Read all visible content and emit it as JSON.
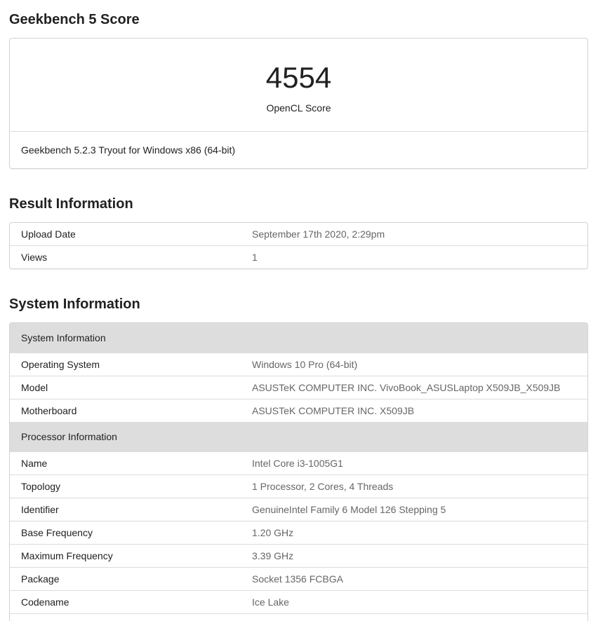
{
  "score_section": {
    "heading": "Geekbench 5 Score",
    "score": "4554",
    "score_label": "OpenCL Score",
    "version": "Geekbench 5.2.3 Tryout for Windows x86 (64-bit)"
  },
  "result_section": {
    "heading": "Result Information",
    "rows": [
      {
        "name": "Upload Date",
        "value": "September 17th 2020, 2:29pm"
      },
      {
        "name": "Views",
        "value": "1"
      }
    ]
  },
  "system_section": {
    "heading": "System Information",
    "system_header": "System Information",
    "system_rows": [
      {
        "name": "Operating System",
        "value": "Windows 10 Pro (64-bit)"
      },
      {
        "name": "Model",
        "value": "ASUSTeK COMPUTER INC. VivoBook_ASUSLaptop X509JB_X509JB"
      },
      {
        "name": "Motherboard",
        "value": "ASUSTeK COMPUTER INC. X509JB"
      }
    ],
    "processor_header": "Processor Information",
    "processor_rows": [
      {
        "name": "Name",
        "value": "Intel Core i3-1005G1"
      },
      {
        "name": "Topology",
        "value": "1 Processor, 2 Cores, 4 Threads"
      },
      {
        "name": "Identifier",
        "value": "GenuineIntel Family 6 Model 126 Stepping 5"
      },
      {
        "name": "Base Frequency",
        "value": "1.20 GHz"
      },
      {
        "name": "Maximum Frequency",
        "value": "3.39 GHz"
      },
      {
        "name": "Package",
        "value": "Socket 1356 FCBGA"
      },
      {
        "name": "Codename",
        "value": "Ice Lake"
      }
    ]
  }
}
